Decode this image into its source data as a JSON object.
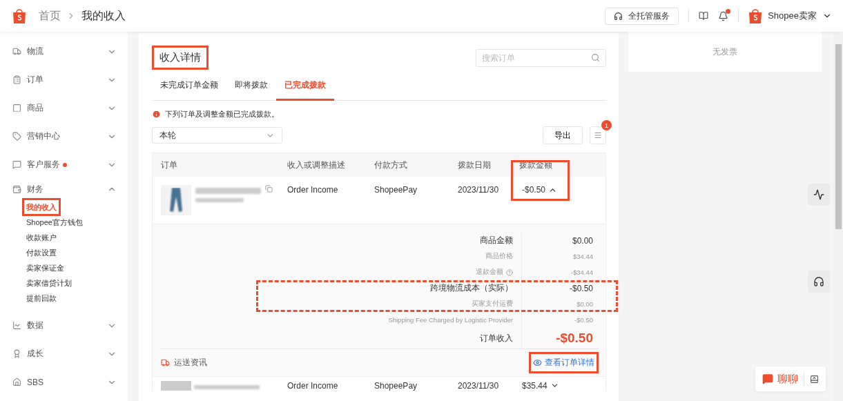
{
  "header": {
    "breadcrumb": [
      "首页",
      "我的收入"
    ],
    "service_button": "全托管服务",
    "notification_dot": true,
    "account": "Shopee卖家"
  },
  "sidebar": {
    "items": [
      {
        "label": "物流",
        "expanded": false,
        "dot": false
      },
      {
        "label": "订单",
        "expanded": false,
        "dot": false
      },
      {
        "label": "商品",
        "expanded": false,
        "dot": false
      },
      {
        "label": "营销中心",
        "expanded": false,
        "dot": false
      },
      {
        "label": "客户服务",
        "expanded": false,
        "dot": true
      },
      {
        "label": "财务",
        "expanded": true,
        "dot": false,
        "children": [
          {
            "label": "我的收入",
            "selected": true,
            "highlight": true
          },
          {
            "label": "Shopee官方钱包",
            "selected": false,
            "highlight": false
          },
          {
            "label": "收款账户",
            "selected": false,
            "highlight": false
          },
          {
            "label": "付款设置",
            "selected": false,
            "highlight": false
          },
          {
            "label": "卖家保证金",
            "selected": false,
            "highlight": false
          },
          {
            "label": "卖家借贷计划",
            "selected": false,
            "highlight": false
          },
          {
            "label": "提前回款",
            "selected": false,
            "highlight": false
          }
        ]
      },
      {
        "label": "数据",
        "expanded": false,
        "dot": false
      },
      {
        "label": "成长",
        "expanded": false,
        "dot": false
      },
      {
        "label": "SBS",
        "expanded": false,
        "dot": false
      }
    ]
  },
  "panel": {
    "title": "收入详情",
    "title_highlight": true,
    "search": {
      "placeholder": "搜索订单"
    },
    "tabs": [
      {
        "label": "未完成订单金额",
        "selected": false
      },
      {
        "label": "即将拨款",
        "selected": false
      },
      {
        "label": "已完成拨款",
        "selected": true
      }
    ],
    "notice": "下列订单及调整金额已完成拨款。",
    "period_select": {
      "value": "本轮"
    },
    "export_button": "导出",
    "filter_badge": "1",
    "table": {
      "columns": [
        {
          "label": "订单",
          "highlight": false
        },
        {
          "label": "收入或调整描述",
          "highlight": false
        },
        {
          "label": "付款方式",
          "highlight": false
        },
        {
          "label": "拨款日期",
          "highlight": false
        },
        {
          "label": "拨款金额",
          "highlight": true
        }
      ],
      "rows": [
        {
          "description": "Order Income",
          "payment": "ShopeePay",
          "date": "2023/11/30",
          "amount": "-$0.50",
          "expanded": true,
          "details": [
            {
              "label": "商品金额",
              "value": "$0.00",
              "kind": "main",
              "help": false,
              "highlight": false
            },
            {
              "label": "商品价格",
              "value": "$34.44",
              "kind": "sub",
              "help": false,
              "highlight": false
            },
            {
              "label": "退款金额",
              "value": "-$34.44",
              "kind": "sub",
              "help": true,
              "highlight": false
            },
            {
              "label": "跨境物流成本（实际）",
              "value": "-$0.50",
              "kind": "main",
              "help": false,
              "highlight": true
            },
            {
              "label": "买家支付运费",
              "value": "$0.00",
              "kind": "sub",
              "help": false,
              "highlight": true
            },
            {
              "label": "Shipping Fee Charged by Logistic Provider",
              "value": "-$0.50",
              "kind": "sub",
              "help": false,
              "highlight": false
            },
            {
              "label": "订单收入",
              "value": "-$0.50",
              "kind": "total",
              "help": false,
              "highlight": false
            }
          ],
          "shipping_label": "运送资讯",
          "view_link": "查看订单详情",
          "view_link_highlight": true
        },
        {
          "description": "Order Income",
          "payment": "ShopeePay",
          "date": "2023/11/30",
          "amount": "$35.44",
          "expanded": false
        }
      ]
    }
  },
  "invoice_card": {
    "text": "无发票"
  },
  "chat": {
    "label": "聊聊"
  }
}
